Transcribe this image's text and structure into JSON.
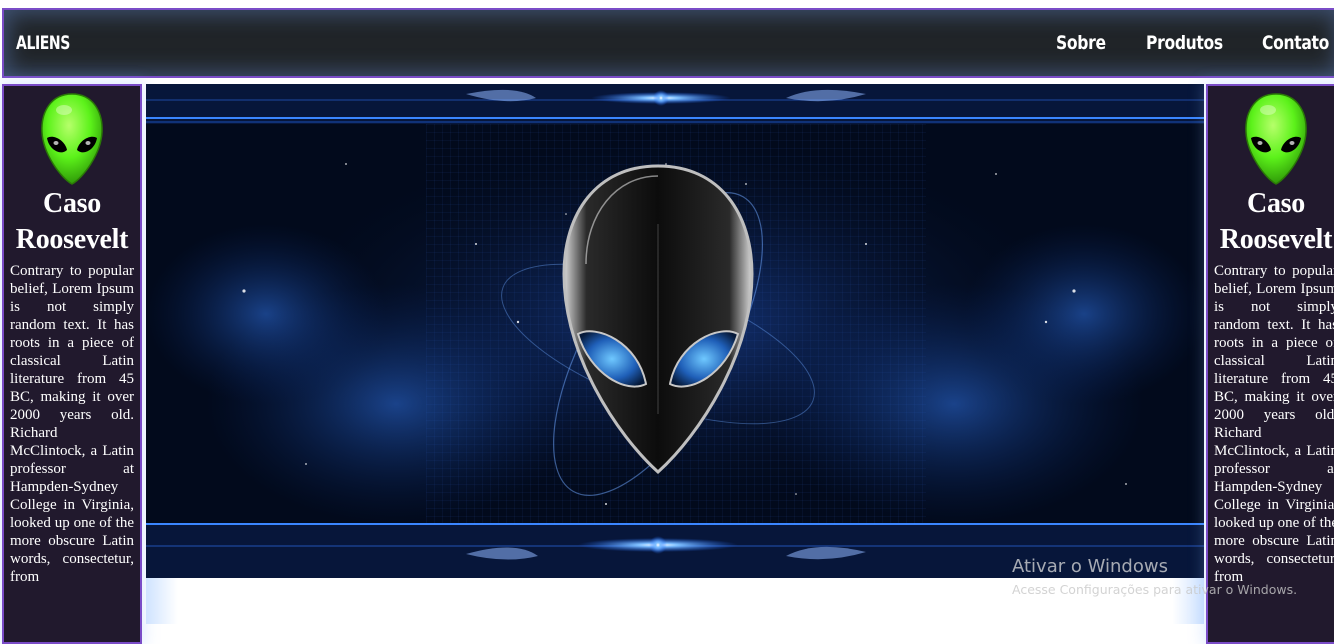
{
  "nav": {
    "brand": "ALIENS",
    "links": [
      "Sobre",
      "Produtos",
      "Contato"
    ]
  },
  "sidebar": {
    "title_line1": "Caso",
    "title_line2": "Roosevelt",
    "text": "Contrary to popular belief, Lorem Ipsum is not simply random text. It has roots in a piece of classical Latin literature from 45 BC, making it over 2000 years old. Richard McClintock, a Latin professor at Hampden-Sydney College in Virginia, looked up one of the more obscure Latin words, consectetur, from"
  },
  "watermark": {
    "title": "Ativar o Windows",
    "subtitle": "Acesse Configurações para ativar o Windows."
  },
  "colors": {
    "nav_bg": "#202428",
    "border_accent": "#7a4cc7",
    "sidebar_bg": "#21192d",
    "alien_green": "#5cf21a",
    "banner_glow": "#2e7bff"
  }
}
